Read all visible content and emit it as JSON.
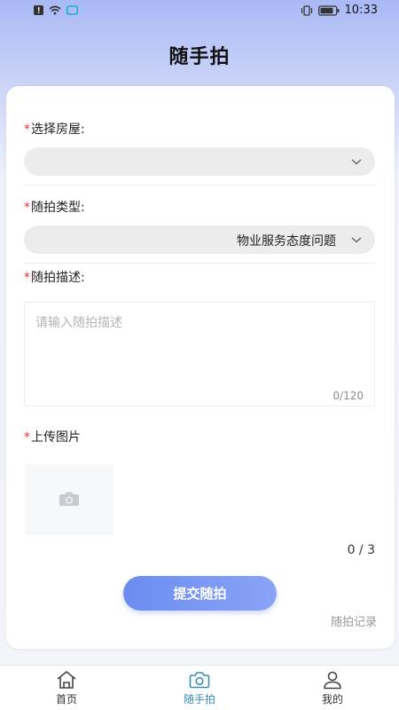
{
  "status_bar": {
    "time": "10:33",
    "icons": [
      "alert-icon",
      "wifi-icon",
      "screen-icon",
      "vibrate-icon",
      "battery-icon"
    ]
  },
  "header": {
    "title": "随手拍"
  },
  "form": {
    "house": {
      "required_mark": "*",
      "label": "选择房屋:",
      "value": ""
    },
    "type": {
      "required_mark": "*",
      "label": "随拍类型:",
      "value": "物业服务态度问题"
    },
    "description": {
      "required_mark": "*",
      "label": "随拍描述:",
      "placeholder": "请输入随拍描述",
      "counter": "0/120"
    },
    "images": {
      "required_mark": "*",
      "label": "上传图片",
      "count": "0 / 3"
    },
    "submit_label": "提交随拍",
    "records_link": "随拍记录"
  },
  "bottom_nav": {
    "items": [
      {
        "label": "首页",
        "icon": "home-icon"
      },
      {
        "label": "随手拍",
        "icon": "camera-icon",
        "active": true
      },
      {
        "label": "我的",
        "icon": "user-icon"
      }
    ]
  },
  "colors": {
    "accent": "#3a8fb5",
    "button_start": "#6b8cf0",
    "button_end": "#8aa3f6",
    "required": "#e33333"
  }
}
